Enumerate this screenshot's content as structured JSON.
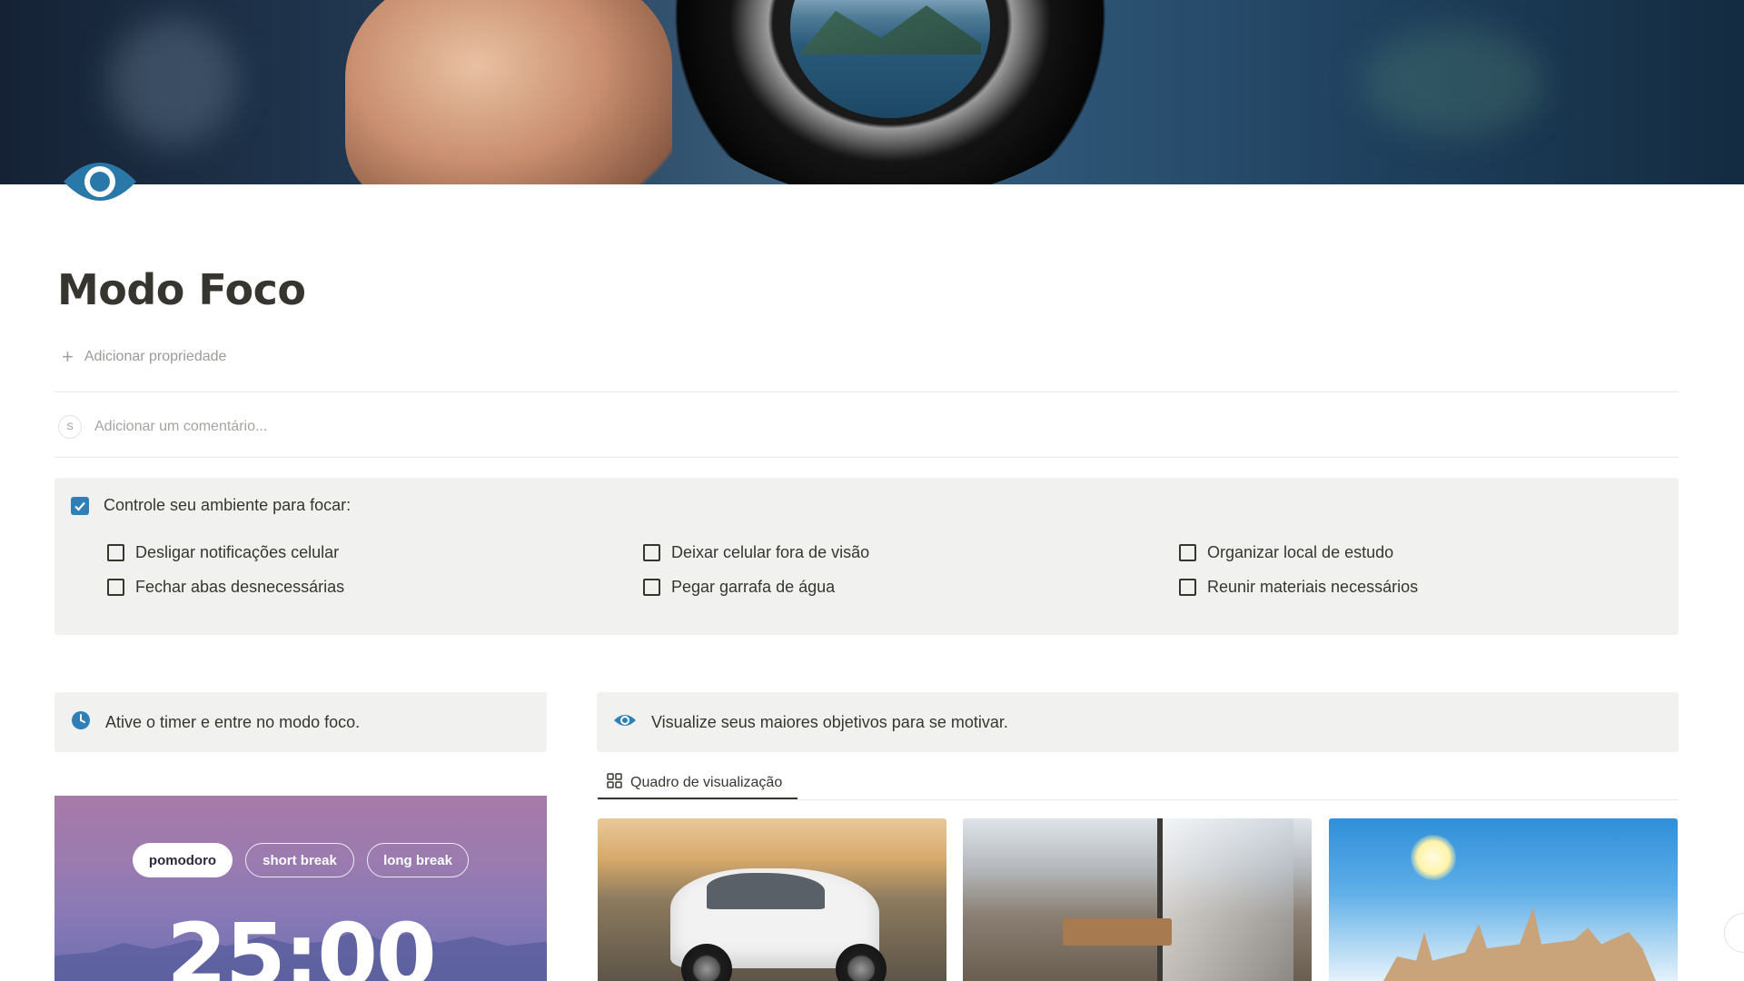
{
  "page": {
    "title": "Modo Foco",
    "add_property_label": "Adicionar propriedade",
    "comment_avatar": "S",
    "comment_placeholder": "Adicionar um comentário..."
  },
  "focus_callout": {
    "heading": "Controle seu ambiente para focar:",
    "heading_checked": true,
    "todos": [
      {
        "label": "Desligar notificações celular",
        "checked": false
      },
      {
        "label": "Fechar abas desnecessárias",
        "checked": false
      },
      {
        "label": "Deixar celular fora de visão",
        "checked": false
      },
      {
        "label": "Pegar garrafa de água",
        "checked": false
      },
      {
        "label": "Organizar local de estudo",
        "checked": false
      },
      {
        "label": "Reunir materiais necessários",
        "checked": false
      }
    ]
  },
  "timer_callout": {
    "text": "Ative o timer e entre no modo foco.",
    "icon": "clock-icon"
  },
  "goal_callout": {
    "text": "Visualize seus maiores objetivos para se motivar.",
    "icon": "eye-icon"
  },
  "gallery": {
    "tab_label": "Quadro de visualização",
    "tab_icon": "gallery-grid-icon",
    "cards": [
      {
        "image": "white-car"
      },
      {
        "image": "apartment-interior"
      },
      {
        "image": "world-travel-landmarks"
      }
    ]
  },
  "timer": {
    "modes": [
      "pomodoro",
      "short break",
      "long break"
    ],
    "active_mode": "pomodoro",
    "time": "25:00"
  },
  "colors": {
    "accent_blue": "#2f7fb8",
    "text": "#37352f",
    "muted": "#9b9a97",
    "callout_bg": "#f1f1ef"
  }
}
